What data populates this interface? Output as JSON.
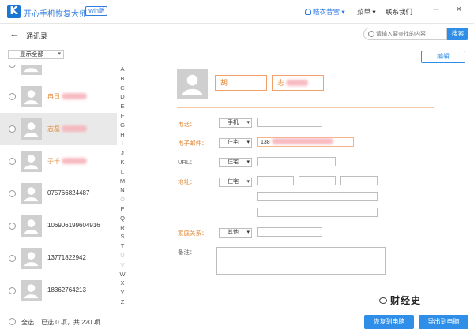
{
  "titlebar": {
    "logo_letter": "K",
    "app_title": "开心手机恢复大师",
    "edition": "Win版",
    "user": "皓衣昔雪",
    "user_caret": "▾",
    "menu": "菜单",
    "menu_caret": "▾",
    "contact": "联系我们",
    "minimize": "─",
    "close": "✕"
  },
  "nav": {
    "back_glyph": "←",
    "page_title": "通讯录",
    "search_placeholder": "请输入要查找的内容",
    "search_button": "搜索"
  },
  "left": {
    "filter_label": "显示全部",
    "filter_caret": "▾",
    "contacts": [
      {
        "name": "",
        "blurred": true,
        "partial": true
      },
      {
        "name": "冉日",
        "blurred": true
      },
      {
        "name": "志磊",
        "blurred": true,
        "selected": true
      },
      {
        "name": "子千",
        "blurred": true
      },
      {
        "name": "075766824487"
      },
      {
        "name": "106906199604916"
      },
      {
        "name": "13771822942"
      },
      {
        "name": "18362764213"
      }
    ],
    "alphabet": [
      "A",
      "B",
      "C",
      "D",
      "E",
      "F",
      "G",
      "H",
      "I",
      "J",
      "K",
      "L",
      "M",
      "N",
      "O",
      "P",
      "Q",
      "R",
      "S",
      "T",
      "U",
      "V",
      "W",
      "X",
      "Y",
      "Z"
    ],
    "dim_letters": [
      "I",
      "O",
      "U",
      "V"
    ]
  },
  "detail": {
    "edit_button": "编辑",
    "first_name": "胡",
    "last_name": "志",
    "phone_label": "电话：",
    "phone_type": "手机",
    "email_label": "电子邮件：",
    "email_type": "住宅",
    "email_value": "138",
    "url_label": "URL：",
    "url_type": "住宅",
    "address_label": "地址：",
    "address_type": "住宅",
    "family_label": "家庭关系：",
    "family_type": "其他",
    "notes_label": "备注：",
    "caret": "▾"
  },
  "bottom": {
    "select_all": "全选",
    "count_text": "已选 0 项，共 220 项",
    "recover_button": "恢复到电脑",
    "export_button": "导出到电脑"
  },
  "watermark": {
    "text": "财经史"
  },
  "colors": {
    "accent": "#2f8fe8",
    "label_orange": "#e08a3a",
    "selected_row": "#e9e9e9"
  }
}
